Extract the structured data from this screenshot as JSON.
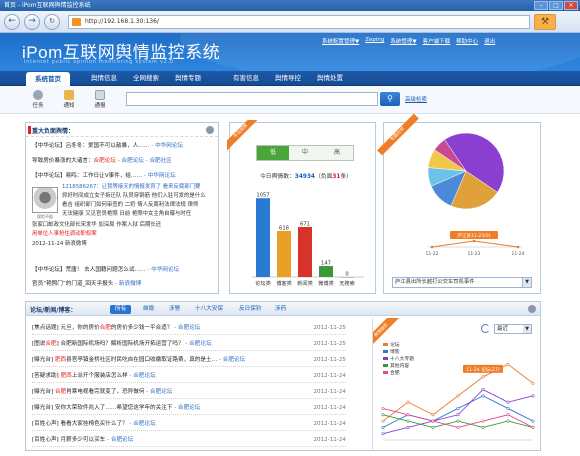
{
  "window": {
    "title": "首页 - iPom互联网舆情监控系统",
    "url": "http://192.168.1.30:136/"
  },
  "header": {
    "logo": "iPom互联网舆情监控系统",
    "subtitle": "Internet public opinion monitoring system v2.0",
    "links": [
      "系统配置管理▼",
      "Zeping",
      "系统管理▼",
      "客户端下载",
      "帮助中心",
      "退出"
    ]
  },
  "nav": {
    "tabs": [
      "系统首页",
      "舆情信息",
      "全网搜索",
      "舆情专题",
      "有害信息",
      "舆情导控",
      "舆情处置"
    ]
  },
  "toolbar": {
    "tools": [
      "任务",
      "通知",
      "通报"
    ],
    "advanced": "高级检索"
  },
  "neg": {
    "title": "重大负面舆情：",
    "items": [
      {
        "pre": "【中华论坛】",
        "body": "吕冬冬：爱国不可以敌暴，人……",
        "src": "- 中华网论坛"
      },
      {
        "pre": "导致房价暴涨的大诸言：",
        "body": "",
        "hl": "合肥论坛",
        "body2": "- 合肥论坛",
        "src": "- 合肥社区"
      },
      {
        "pre": "【中华论坛】",
        "body": "易鸣：工作日让V事件，给……",
        "src": "- 中华网论坛"
      }
    ],
    "thumb_caption": "保险不赔",
    "article": [
      "1218586267：让我等接天的情报发育了 看来反腐部门要",
      "抓好时间成立女子拆迁队 队员穿钢筋 他们入驻可发的是什么",
      "看吉 组织部门如何审查的 二奶 情人反腐利法律法规 律师",
      "无法健康 又见官员艳照 日前 艳照中女主角自曝与时任",
      "张家口邮政文化部长宋发华 加深局 作案入狱 后期长还",
      "用单位人事抢住调动职权案",
      "2012-11-24 新浪微博"
    ],
    "items2": [
      {
        "pre": "【中华论坛】",
        "body": "荒唐！ 去人国籍问题怎么试……",
        "src": "- 中华网论坛"
      },
      {
        "pre": "官员“艳照门”的门道_回天乎报头",
        "body": "",
        "src": "- 新浪微博"
      }
    ]
  },
  "today": {
    "ribbon": "今日舆情",
    "segs": [
      "低",
      "中",
      "高"
    ],
    "count_label": "今日舆情数：",
    "count": "34934",
    "count_neg_label": "（负面",
    "count_neg": "31",
    "count_tail": "条）"
  },
  "chart_data": [
    {
      "type": "bar",
      "categories": [
        "论坛类",
        "博客类",
        "新闻类",
        "微博类",
        "无搜索"
      ],
      "values": [
        1057,
        618,
        671,
        147,
        0
      ],
      "colors": [
        "#2a7ad3",
        "#e8a126",
        "#d6332a",
        "#3a9a38",
        "#888888"
      ]
    },
    {
      "type": "pie",
      "ribbon": "专题分析",
      "labels": [
        "A",
        "B",
        "C",
        "D",
        "E",
        "F"
      ],
      "values": [
        44,
        22,
        12,
        8,
        8,
        6
      ],
      "colors": [
        "#8b3fd1",
        "#e0a03a",
        "#4a8ad8",
        "#6cc2e8",
        "#f1c84a",
        "#c94a8e"
      ],
      "trend_label": "庐江县11-23(9)",
      "x": [
        "11-22",
        "11-23",
        "11-24"
      ],
      "select": "庐江县出所长越打公交车司机事件"
    },
    {
      "type": "line",
      "x": [
        "11-20",
        "11-21",
        "11-22",
        "11-23",
        "11-24",
        "11-25",
        "11-26"
      ],
      "series": [
        {
          "name": "论坛",
          "color": "#e57d2b",
          "values": [
            3,
            6,
            4,
            7,
            10,
            12,
            9
          ]
        },
        {
          "name": "博客",
          "color": "#2a7ad3",
          "values": [
            2,
            4,
            3,
            5,
            7,
            5,
            3
          ]
        },
        {
          "name": "十八大专题",
          "color": "#8b3fd1",
          "values": [
            1,
            2,
            3,
            4,
            8,
            6,
            7
          ]
        },
        {
          "name": "其他内容",
          "color": "#3a9a38",
          "values": [
            4,
            3,
            2,
            3,
            2,
            3,
            2
          ]
        },
        {
          "name": "合肥",
          "color": "#e04a8e",
          "values": [
            5,
            4,
            3,
            2,
            3,
            4,
            2
          ]
        }
      ],
      "callout": "11-24 论坛(27)"
    }
  ],
  "list": {
    "title": "论坛/新闻/博客：",
    "tabs": [
      "所有",
      "维稳",
      "涉警",
      "十八大安保",
      "反日保钓",
      "涉药"
    ],
    "rows": [
      {
        "ti": "[焦点话题] 元旦，你的房价",
        "hl": "合肥",
        "ti2": "的房价多少钱一平合适？",
        "sr": "- 合肥论坛",
        "dt": "2012-11-25"
      },
      {
        "ti": "[图说",
        "hl": "合肥",
        "ti2": "] 合肥新国际机场吗？解析国际机场开拓运营了吗？",
        "sr": "- 合肥论坛",
        "dt": "2012-11-25"
      },
      {
        "ti": "[曝光台] ",
        "hl": "肥西",
        "ti2": "县官亭镇金桥社区时民吃自在园口收缴取证路费，真的是土…",
        "sr": "- 合肥论坛",
        "dt": "2012-11-25"
      },
      {
        "ti": "[答疑求助] ",
        "hl": "肥西",
        "ti2": "上派开个服装店怎么样",
        "sr": "- 合肥论坛",
        "dt": "2012-11-24"
      },
      {
        "ti": "[曝光台] ",
        "hl": "合肥",
        "ti2": "肖寒电视看完就变了，恐异做何",
        "sr": "- 合肥论坛",
        "dt": "2012-11-24"
      },
      {
        "ti": "[曝光台] 安你大荣软件兆入了……",
        "hl": "",
        "ti2": "希望您这学年的关注下",
        "sr": "- 合肥论坛",
        "dt": "2012-11-24"
      },
      {
        "ti": "[百姓心声] 看看大家挂椅色买什么了？",
        "hl": "",
        "ti2": "",
        "sr": "- 合肥论坛",
        "dt": "2012-11-24"
      },
      {
        "ti": "[百姓心声] 月薪多少可以买车",
        "hl": "",
        "ti2": "",
        "sr": "- 合肥论坛",
        "dt": "2012-11-24"
      }
    ],
    "trend_ribbon": "舆情趋势",
    "trend_select": "最近"
  }
}
